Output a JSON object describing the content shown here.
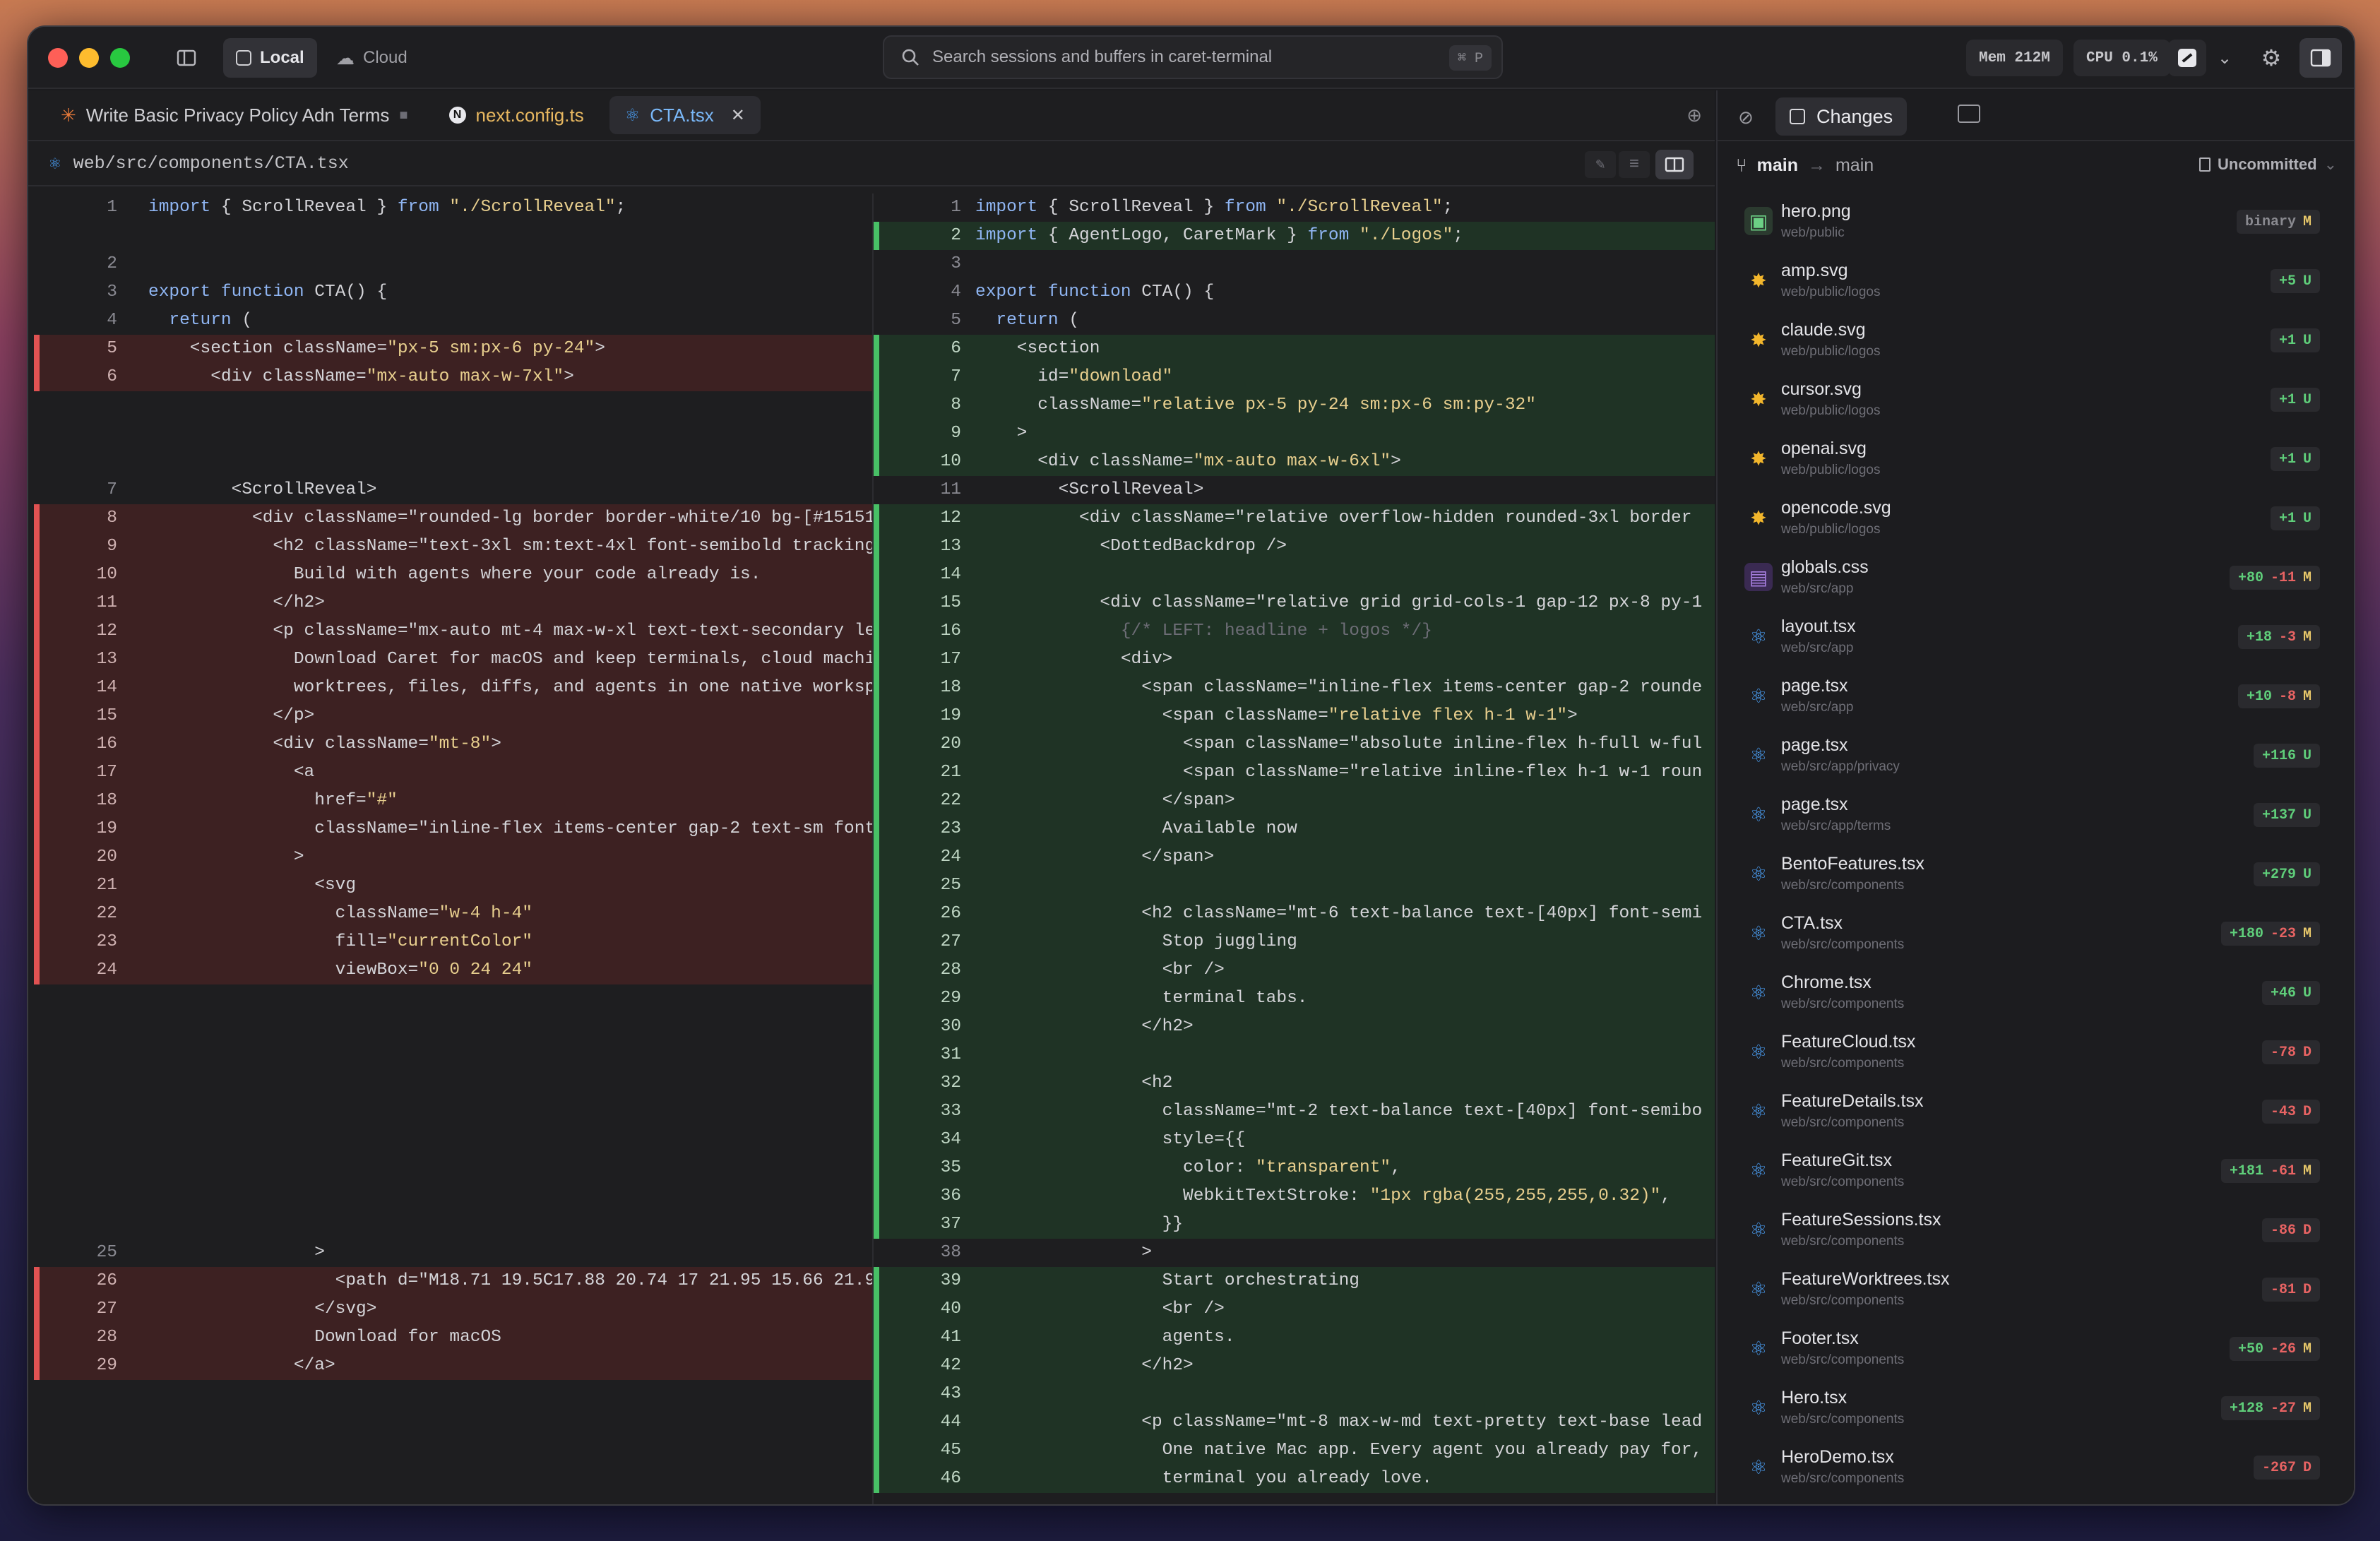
{
  "titlebar": {
    "local_label": "Local",
    "cloud_label": "Cloud",
    "search_placeholder": "Search sessions and buffers in caret-terminal",
    "search_shortcut": "⌘ P",
    "mem": "Mem 212M",
    "cpu": "CPU 0.1%"
  },
  "editor": {
    "tabs": [
      {
        "label": "Write Basic Privacy Policy Adn Terms"
      },
      {
        "label": "next.config.ts"
      },
      {
        "label": "CTA.tsx"
      }
    ],
    "path": "web/src/components/CTA.tsx"
  },
  "diff": {
    "left": [
      {
        "n": "1",
        "t": "import { ScrollReveal } from \"./ScrollReveal\";",
        "k": "ctx",
        "y": 0
      },
      {
        "n": "2",
        "t": "",
        "k": "ctx",
        "y": 2
      },
      {
        "n": "3",
        "t": "export function CTA() {",
        "k": "ctx",
        "y": 3
      },
      {
        "n": "4",
        "t": "  return (",
        "k": "ctx",
        "y": 4
      },
      {
        "n": "5",
        "t": "    <section className=\"px-5 sm:px-6 py-24\">",
        "k": "del",
        "y": 5
      },
      {
        "n": "6",
        "t": "      <div className=\"mx-auto max-w-7xl\">",
        "k": "del",
        "y": 6
      },
      {
        "n": "7",
        "t": "        <ScrollReveal>",
        "k": "ctx",
        "y": 10
      },
      {
        "n": "8",
        "t": "          <div className=\"rounded-lg border border-white/10 bg-[#15151",
        "k": "del",
        "y": 11
      },
      {
        "n": "9",
        "t": "            <h2 className=\"text-3xl sm:text-4xl font-semibold tracking",
        "k": "del",
        "y": 12
      },
      {
        "n": "10",
        "t": "              Build with agents where your code already is.",
        "k": "del",
        "y": 13
      },
      {
        "n": "11",
        "t": "            </h2>",
        "k": "del",
        "y": 14
      },
      {
        "n": "12",
        "t": "            <p className=\"mx-auto mt-4 max-w-xl text-text-secondary le",
        "k": "del",
        "y": 15
      },
      {
        "n": "13",
        "t": "              Download Caret for macOS and keep terminals, cloud machi",
        "k": "del",
        "y": 16
      },
      {
        "n": "14",
        "t": "              worktrees, files, diffs, and agents in one native worksp",
        "k": "del",
        "y": 17
      },
      {
        "n": "15",
        "t": "            </p>",
        "k": "del",
        "y": 18
      },
      {
        "n": "16",
        "t": "            <div className=\"mt-8\">",
        "k": "del",
        "y": 19
      },
      {
        "n": "17",
        "t": "              <a",
        "k": "del",
        "y": 20
      },
      {
        "n": "18",
        "t": "                href=\"#\"",
        "k": "del",
        "y": 21
      },
      {
        "n": "19",
        "t": "                className=\"inline-flex items-center gap-2 text-sm font",
        "k": "del",
        "y": 22
      },
      {
        "n": "20",
        "t": "              >",
        "k": "del",
        "y": 23
      },
      {
        "n": "21",
        "t": "                <svg",
        "k": "del",
        "y": 24
      },
      {
        "n": "22",
        "t": "                  className=\"w-4 h-4\"",
        "k": "del",
        "y": 25
      },
      {
        "n": "23",
        "t": "                  fill=\"currentColor\"",
        "k": "del",
        "y": 26
      },
      {
        "n": "24",
        "t": "                  viewBox=\"0 0 24 24\"",
        "k": "del",
        "y": 27
      },
      {
        "n": "25",
        "t": "                >",
        "k": "ctx",
        "y": 37
      },
      {
        "n": "26",
        "t": "                  <path d=\"M18.71 19.5C17.88 20.74 17 21.95 15.66 21.9",
        "k": "del",
        "y": 38
      },
      {
        "n": "27",
        "t": "                </svg>",
        "k": "del",
        "y": 39
      },
      {
        "n": "28",
        "t": "                Download for macOS",
        "k": "del",
        "y": 40
      },
      {
        "n": "29",
        "t": "              </a>",
        "k": "del",
        "y": 41
      }
    ],
    "right": [
      {
        "n": "1",
        "t": "import { ScrollReveal } from \"./ScrollReveal\";",
        "k": "ctx"
      },
      {
        "n": "2",
        "t": "import { AgentLogo, CaretMark } from \"./Logos\";",
        "k": "add"
      },
      {
        "n": "3",
        "t": "",
        "k": "ctx"
      },
      {
        "n": "4",
        "t": "export function CTA() {",
        "k": "ctx"
      },
      {
        "n": "5",
        "t": "  return (",
        "k": "ctx"
      },
      {
        "n": "6",
        "t": "    <section",
        "k": "add"
      },
      {
        "n": "7",
        "t": "      id=\"download\"",
        "k": "add"
      },
      {
        "n": "8",
        "t": "      className=\"relative px-5 py-24 sm:px-6 sm:py-32\"",
        "k": "add"
      },
      {
        "n": "9",
        "t": "    >",
        "k": "add"
      },
      {
        "n": "10",
        "t": "      <div className=\"mx-auto max-w-6xl\">",
        "k": "add"
      },
      {
        "n": "11",
        "t": "        <ScrollReveal>",
        "k": "ctx"
      },
      {
        "n": "12",
        "t": "          <div className=\"relative overflow-hidden rounded-3xl border",
        "k": "add"
      },
      {
        "n": "13",
        "t": "            <DottedBackdrop />",
        "k": "add"
      },
      {
        "n": "14",
        "t": "",
        "k": "add"
      },
      {
        "n": "15",
        "t": "            <div className=\"relative grid grid-cols-1 gap-12 px-8 py-1",
        "k": "add"
      },
      {
        "n": "16",
        "t": "              {/* LEFT: headline + logos */}",
        "k": "add"
      },
      {
        "n": "17",
        "t": "              <div>",
        "k": "add"
      },
      {
        "n": "18",
        "t": "                <span className=\"inline-flex items-center gap-2 rounde",
        "k": "add"
      },
      {
        "n": "19",
        "t": "                  <span className=\"relative flex h-1 w-1\">",
        "k": "add"
      },
      {
        "n": "20",
        "t": "                    <span className=\"absolute inline-flex h-full w-ful",
        "k": "add"
      },
      {
        "n": "21",
        "t": "                    <span className=\"relative inline-flex h-1 w-1 roun",
        "k": "add"
      },
      {
        "n": "22",
        "t": "                  </span>",
        "k": "add"
      },
      {
        "n": "23",
        "t": "                  Available now",
        "k": "add"
      },
      {
        "n": "24",
        "t": "                </span>",
        "k": "add"
      },
      {
        "n": "25",
        "t": "",
        "k": "add"
      },
      {
        "n": "26",
        "t": "                <h2 className=\"mt-6 text-balance text-[40px] font-semi",
        "k": "add"
      },
      {
        "n": "27",
        "t": "                  Stop juggling",
        "k": "add"
      },
      {
        "n": "28",
        "t": "                  <br />",
        "k": "add"
      },
      {
        "n": "29",
        "t": "                  terminal tabs.",
        "k": "add"
      },
      {
        "n": "30",
        "t": "                </h2>",
        "k": "add"
      },
      {
        "n": "31",
        "t": "",
        "k": "add"
      },
      {
        "n": "32",
        "t": "                <h2",
        "k": "add"
      },
      {
        "n": "33",
        "t": "                  className=\"mt-2 text-balance text-[40px] font-semibo",
        "k": "add"
      },
      {
        "n": "34",
        "t": "                  style={{",
        "k": "add"
      },
      {
        "n": "35",
        "t": "                    color: \"transparent\",",
        "k": "add"
      },
      {
        "n": "36",
        "t": "                    WebkitTextStroke: \"1px rgba(255,255,255,0.32)\",",
        "k": "add"
      },
      {
        "n": "37",
        "t": "                  }}",
        "k": "add"
      },
      {
        "n": "38",
        "t": "                >",
        "k": "ctx"
      },
      {
        "n": "39",
        "t": "                  Start orchestrating",
        "k": "add"
      },
      {
        "n": "40",
        "t": "                  <br />",
        "k": "add"
      },
      {
        "n": "41",
        "t": "                  agents.",
        "k": "add"
      },
      {
        "n": "42",
        "t": "                </h2>",
        "k": "add"
      },
      {
        "n": "43",
        "t": "",
        "k": "add"
      },
      {
        "n": "44",
        "t": "                <p className=\"mt-8 max-w-md text-pretty text-base lead",
        "k": "add"
      },
      {
        "n": "45",
        "t": "                  One native Mac app. Every agent you already pay for,",
        "k": "add"
      },
      {
        "n": "46",
        "t": "                  terminal you already love.",
        "k": "add"
      }
    ]
  },
  "changes": {
    "tab_label": "Changes",
    "branch_from": "main",
    "branch_to": "main",
    "uncommitted": "Uncommitted",
    "files": [
      {
        "name": "hero.png",
        "path": "web/public",
        "badge": "binary",
        "st": "M",
        "icon": "image"
      },
      {
        "name": "amp.svg",
        "path": "web/public/logos",
        "add": "+5",
        "st": "U",
        "icon": "svg"
      },
      {
        "name": "claude.svg",
        "path": "web/public/logos",
        "add": "+1",
        "st": "U",
        "icon": "svg"
      },
      {
        "name": "cursor.svg",
        "path": "web/public/logos",
        "add": "+1",
        "st": "U",
        "icon": "svg"
      },
      {
        "name": "openai.svg",
        "path": "web/public/logos",
        "add": "+1",
        "st": "U",
        "icon": "svg"
      },
      {
        "name": "opencode.svg",
        "path": "web/public/logos",
        "add": "+1",
        "st": "U",
        "icon": "svg"
      },
      {
        "name": "globals.css",
        "path": "web/src/app",
        "add": "+80",
        "del": "-11",
        "st": "M",
        "icon": "css"
      },
      {
        "name": "layout.tsx",
        "path": "web/src/app",
        "add": "+18",
        "del": "-3",
        "st": "M",
        "icon": "react"
      },
      {
        "name": "page.tsx",
        "path": "web/src/app",
        "add": "+10",
        "del": "-8",
        "st": "M",
        "icon": "react"
      },
      {
        "name": "page.tsx",
        "path": "web/src/app/privacy",
        "add": "+116",
        "st": "U",
        "icon": "react"
      },
      {
        "name": "page.tsx",
        "path": "web/src/app/terms",
        "add": "+137",
        "st": "U",
        "icon": "react"
      },
      {
        "name": "BentoFeatures.tsx",
        "path": "web/src/components",
        "add": "+279",
        "st": "U",
        "icon": "react"
      },
      {
        "name": "CTA.tsx",
        "path": "web/src/components",
        "add": "+180",
        "del": "-23",
        "st": "M",
        "icon": "react"
      },
      {
        "name": "Chrome.tsx",
        "path": "web/src/components",
        "add": "+46",
        "st": "U",
        "icon": "react"
      },
      {
        "name": "FeatureCloud.tsx",
        "path": "web/src/components",
        "del": "-78",
        "st": "D",
        "icon": "react"
      },
      {
        "name": "FeatureDetails.tsx",
        "path": "web/src/components",
        "del": "-43",
        "st": "D",
        "icon": "react"
      },
      {
        "name": "FeatureGit.tsx",
        "path": "web/src/components",
        "add": "+181",
        "del": "-61",
        "st": "M",
        "icon": "react"
      },
      {
        "name": "FeatureSessions.tsx",
        "path": "web/src/components",
        "del": "-86",
        "st": "D",
        "icon": "react"
      },
      {
        "name": "FeatureWorktrees.tsx",
        "path": "web/src/components",
        "del": "-81",
        "st": "D",
        "icon": "react"
      },
      {
        "name": "Footer.tsx",
        "path": "web/src/components",
        "add": "+50",
        "del": "-26",
        "st": "M",
        "icon": "react"
      },
      {
        "name": "Hero.tsx",
        "path": "web/src/components",
        "add": "+128",
        "del": "-27",
        "st": "M",
        "icon": "react"
      },
      {
        "name": "HeroDemo.tsx",
        "path": "web/src/components",
        "del": "-267",
        "st": "D",
        "icon": "react"
      }
    ]
  },
  "colors": {
    "accent": "#4a9ff5",
    "added": "#5fce7a",
    "deleted": "#e86363",
    "untracked": "#e8c86a"
  }
}
